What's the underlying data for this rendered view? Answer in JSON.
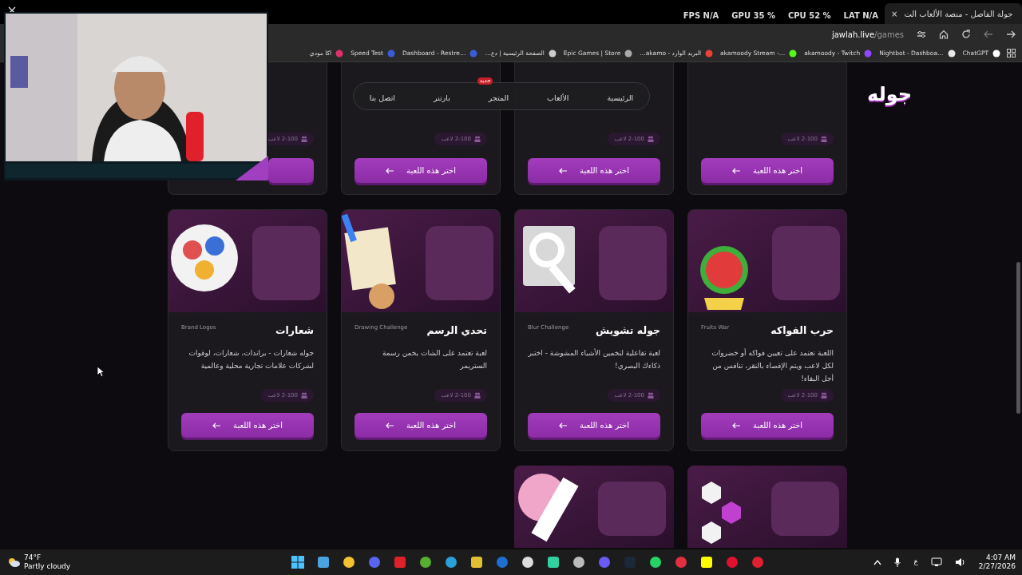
{
  "browser": {
    "tab_title": "جولة الفاصل - منصة الألعاب الت",
    "tab_close": "×",
    "address": {
      "host": "jawlah.live",
      "path": "/games"
    },
    "bookmarks": [
      {
        "label": "ChatGPT"
      },
      {
        "label": "Nightbot - Dashboa…"
      },
      {
        "label": "akamoody - Twitch"
      },
      {
        "label": "akamoody Stream -…"
      },
      {
        "label": "البريد الوارد - akamo…"
      },
      {
        "label": "Epic Games | Store"
      },
      {
        "label": "الصفحة الرئيسية | دع…"
      },
      {
        "label": "Dashboard - Restre…"
      },
      {
        "label": "Speed Test"
      },
      {
        "label": "اكا مودي"
      }
    ]
  },
  "perf_overlay": [
    "LAT N/A",
    "CPU 52 %",
    "GPU 35 %",
    "FPS N/A"
  ],
  "site": {
    "logo": "جوله",
    "nav": [
      {
        "label": "الرئيسية"
      },
      {
        "label": "الألعاب"
      },
      {
        "label": "المتجر",
        "badge": "جديد"
      },
      {
        "label": "بارتنر"
      },
      {
        "label": "اتصل بنا"
      }
    ]
  },
  "games": [
    {
      "kind": "partial_top",
      "players": "2-100 لاعب",
      "button": "اختر هذه اللعبة"
    },
    {
      "kind": "partial_top",
      "players": "2-100 لاعب",
      "button": "اختر هذه اللعبة"
    },
    {
      "kind": "partial_top",
      "players": "2-100 لاعب",
      "button": "اختر هذه اللعبة"
    },
    {
      "kind": "partial_top",
      "players": "2-100 لاعب"
    },
    {
      "kind": "full",
      "title": "حرب الفواكه",
      "subtitle": "Fruits War",
      "description": "اللعبة تعتمد على تعيين فواكه أو خضروات لكل لاعب ويتم الإقصاء بالنقر، تنافس من أجل البقاء!",
      "players": "2-100 لاعب",
      "button": "اختر هذه اللعبة"
    },
    {
      "kind": "full",
      "title": "جوله تشويش",
      "subtitle": "Blur Challenge",
      "description": "لعبة تفاعلية لتخمين الأشياء المشوشة - اختبر ذكاءك البصري!",
      "players": "2-100 لاعب",
      "button": "اختر هذه اللعبة"
    },
    {
      "kind": "full",
      "title": "تحدي الرسم",
      "subtitle": "Drawing Challenge",
      "description": "لعبة تعتمد على الشات يخمن رسمة الستريمر",
      "players": "2-100 لاعب",
      "button": "اختر هذه اللعبة"
    },
    {
      "kind": "full",
      "title": "شعارات",
      "subtitle": "Brand Logos",
      "description": "جوله شعارات - براندات، شعارات، لوقوات لشركات علامات تجارية محلية وعالمية",
      "players": "2-100 لاعب",
      "button": "اختر هذه اللعبة"
    },
    {
      "kind": "partial_bottom"
    },
    {
      "kind": "partial_bottom"
    }
  ],
  "taskbar": {
    "temperature": "74°F",
    "weather": "Partly cloudy",
    "language": "ع",
    "time": "4:07 AM",
    "date": "2/27/2026"
  }
}
